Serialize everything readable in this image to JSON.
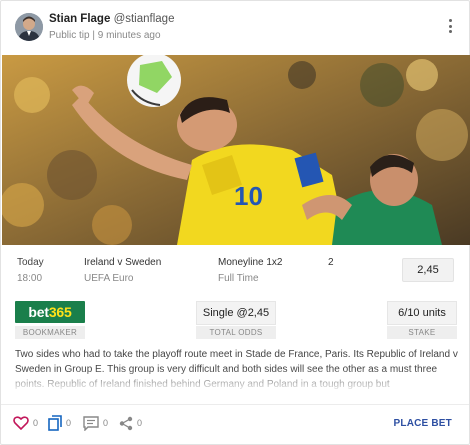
{
  "author": {
    "name": "Stian Flage",
    "handle": "@stianflage",
    "meta": "Public tip | 9 minutes ago"
  },
  "match": {
    "date": "Today",
    "time": "18:00",
    "teams": "Ireland v Sweden",
    "competition": "UEFA Euro",
    "market": "Moneyline 1x2",
    "period": "Full Time",
    "selection": "2",
    "odds": "2,45"
  },
  "bookmaker": {
    "logo_part1": "bet",
    "logo_part2": "365",
    "label": "BOOKMAKER"
  },
  "total_odds": {
    "value": "Single @2,45",
    "label": "TOTAL ODDS"
  },
  "stake": {
    "value": "6/10 units",
    "label": "STAKE"
  },
  "description": "Two sides who had to take the playoff route meet in Stade de France, Paris. Its Republic of Ireland v Sweden in Group E. This group is very difficult and both sides will see the other as a must three points. Republic of Ireland finished behind Germany and Poland in a tough group but",
  "actions": {
    "likes": "0",
    "copies": "0",
    "comments": "0",
    "shares": "0",
    "place_bet": "PLACE BET"
  },
  "photo": {
    "jersey_number": "10"
  },
  "colors": {
    "bookmaker_green": "#1a7f4b",
    "bookmaker_yellow": "#ffe11a",
    "link_blue": "#2d4fa2",
    "like_pink": "#c2185b",
    "copy_blue": "#1565c0"
  }
}
